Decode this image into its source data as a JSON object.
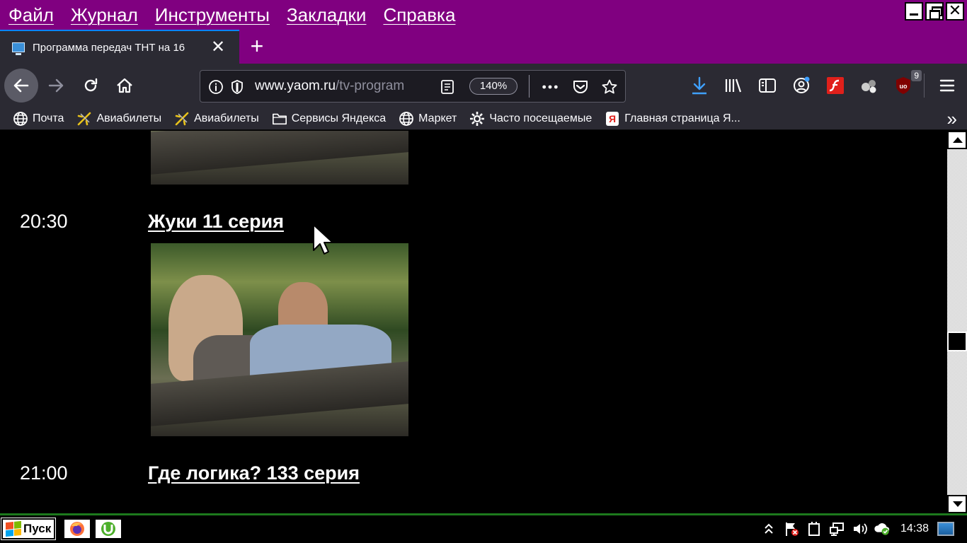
{
  "menubar": {
    "items": [
      "Файл",
      "Журнал",
      "Инструменты",
      "Закладки",
      "Справка"
    ]
  },
  "tab": {
    "title": "Программа передач ТНТ на 16"
  },
  "urlbar": {
    "domain": "www.yaom.ru",
    "path": "/tv-program",
    "zoom": "140%"
  },
  "toolbar": {
    "ublock_badge": "9"
  },
  "bookmarks": [
    {
      "label": "Почта",
      "icon": "globe-icon"
    },
    {
      "label": "Авиабилеты",
      "icon": "plane-icon"
    },
    {
      "label": "Авиабилеты",
      "icon": "plane-icon"
    },
    {
      "label": "Сервисы Яндекса",
      "icon": "folder-icon"
    },
    {
      "label": "Маркет",
      "icon": "globe-icon"
    },
    {
      "label": "Часто посещаемые",
      "icon": "gear-icon"
    },
    {
      "label": "Главная страница Я...",
      "icon": "yandex-icon"
    }
  ],
  "programs": [
    {
      "time": "20:30",
      "title": "Жуки 11 серия"
    },
    {
      "time": "21:00",
      "title": "Где логика? 133 серия"
    }
  ],
  "taskbar": {
    "start_label": "Пуск",
    "clock": "14:38"
  }
}
